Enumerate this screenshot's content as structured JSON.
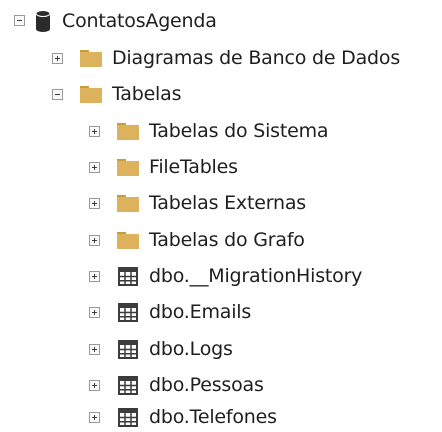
{
  "tree": {
    "root": {
      "label": "ContatosAgenda",
      "icon": "database-icon",
      "state": "expanded"
    },
    "children": [
      {
        "label": "Diagramas de Banco de Dados",
        "icon": "folder-icon",
        "state": "collapsed"
      },
      {
        "label": "Tabelas",
        "icon": "folder-icon",
        "state": "expanded",
        "children": [
          {
            "label": "Tabelas do Sistema",
            "icon": "folder-icon",
            "state": "collapsed"
          },
          {
            "label": "FileTables",
            "icon": "folder-icon",
            "state": "collapsed"
          },
          {
            "label": "Tabelas Externas",
            "icon": "folder-icon",
            "state": "collapsed"
          },
          {
            "label": "Tabelas do Grafo",
            "icon": "folder-icon",
            "state": "collapsed"
          },
          {
            "label": "dbo.__MigrationHistory",
            "icon": "table-icon",
            "state": "collapsed"
          },
          {
            "label": "dbo.Emails",
            "icon": "table-icon",
            "state": "collapsed"
          },
          {
            "label": "dbo.Logs",
            "icon": "table-icon",
            "state": "collapsed"
          },
          {
            "label": "dbo.Pessoas",
            "icon": "table-icon",
            "state": "collapsed"
          },
          {
            "label": "dbo.Telefones",
            "icon": "table-icon",
            "state": "collapsed"
          }
        ]
      }
    ]
  },
  "colors": {
    "folder": "#dcb35c",
    "folder_tab": "#c99a3e",
    "database": "#2b2b2b",
    "table": "#3c3c3c",
    "expander_border": "#9a9a9a"
  }
}
